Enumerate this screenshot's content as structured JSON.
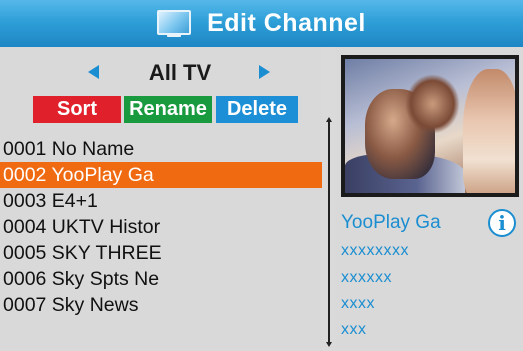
{
  "header": {
    "title": "Edit Channel",
    "icon": "tv-icon"
  },
  "group": {
    "label": "All TV"
  },
  "actions": {
    "sort": "Sort",
    "rename": "Rename",
    "delete": "Delete"
  },
  "channels": [
    {
      "label": "0001 No Name"
    },
    {
      "label": "0002 YooPlay Ga",
      "selected": true
    },
    {
      "label": "0003 E4+1"
    },
    {
      "label": "0004 UKTV Histor"
    },
    {
      "label": "0005 SKY THREE"
    },
    {
      "label": "0006 Sky Spts Ne"
    },
    {
      "label": "0007 Sky News"
    }
  ],
  "info": {
    "name": "YooPlay Ga",
    "info_icon": "i",
    "lines": [
      "xxxxxxxx",
      "xxxxxx",
      "xxxx",
      "xxx"
    ]
  },
  "colors": {
    "title_bar": "#2f9fd8",
    "selection": "#f06a12",
    "sort": "#e0202a",
    "rename": "#1a9a3e",
    "delete": "#1d8fd6",
    "accent_text": "#1b8ed1"
  }
}
